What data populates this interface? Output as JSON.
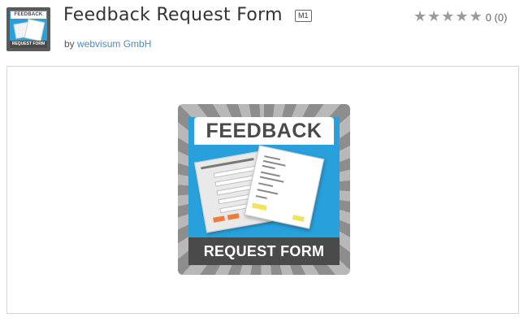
{
  "app": {
    "title": "Feedback Request Form",
    "badge": "M1",
    "vendor_prefix": "by",
    "vendor_name": "webvisum GmbH"
  },
  "rating": {
    "stars_filled": 0,
    "stars_total": 5,
    "text": "0 (0)"
  },
  "thumbnail": {
    "top_text": "FEEDBACK",
    "bottom_text": "REQUEST FORM"
  },
  "hero": {
    "top_text": "FEEDBACK",
    "bottom_text": "REQUEST FORM"
  },
  "icons": {
    "star": "star-icon"
  },
  "colors": {
    "accent_blue": "#27a0dc",
    "vendor_link": "#4f8ab1",
    "star_empty": "#9b9b9b"
  }
}
